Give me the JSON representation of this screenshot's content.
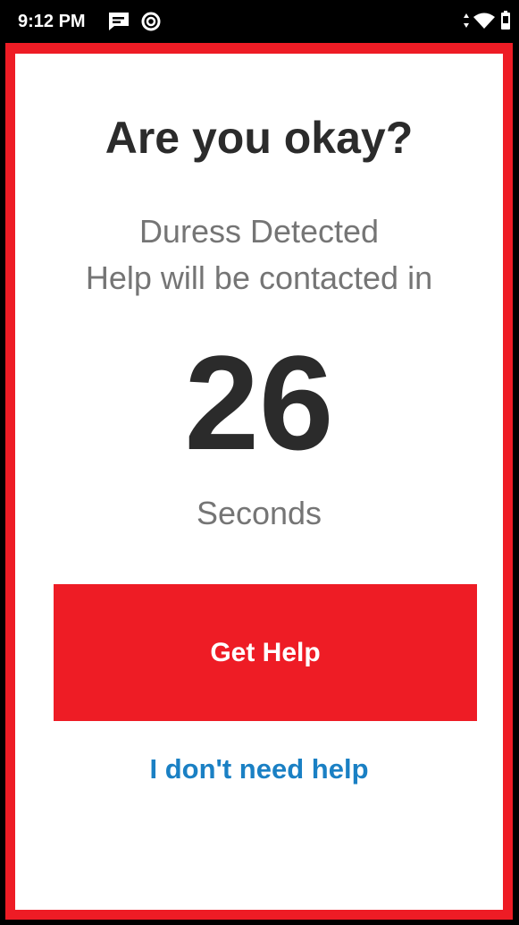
{
  "status_bar": {
    "time": "9:12 PM",
    "icons": [
      "message-icon",
      "sync-icon",
      "signal-icon",
      "wifi-icon",
      "battery-icon"
    ]
  },
  "dialog": {
    "title": "Are you okay?",
    "subtitle_line1": "Duress Detected",
    "subtitle_line2": "Help will be contacted in",
    "countdown_value": "26",
    "countdown_unit": "Seconds",
    "get_help_label": "Get Help",
    "no_help_label": "I don't need help"
  },
  "colors": {
    "accent_red": "#ee1c25",
    "link_blue": "#1a80c4",
    "heading_text": "#2b2b2b",
    "secondary_text": "#757575"
  }
}
